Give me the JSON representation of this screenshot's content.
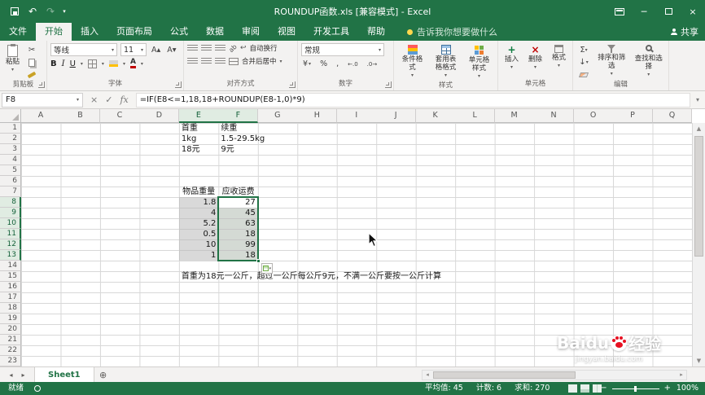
{
  "title_bar": {
    "title": "ROUNDUP函数.xls [兼容模式] - Excel"
  },
  "ribbon": {
    "tabs": [
      {
        "label": "文件",
        "type": "file"
      },
      {
        "label": "开始",
        "active": true
      },
      {
        "label": "插入"
      },
      {
        "label": "页面布局"
      },
      {
        "label": "公式"
      },
      {
        "label": "数据"
      },
      {
        "label": "审阅"
      },
      {
        "label": "视图"
      },
      {
        "label": "开发工具"
      },
      {
        "label": "帮助"
      }
    ],
    "tell_me": "告诉我你想要做什么",
    "share": "共享",
    "clipboard": {
      "paste": "粘贴"
    },
    "font": {
      "name": "等线",
      "size": "11"
    },
    "alignment": {
      "wrap": "自动换行",
      "merge": "合并后居中"
    },
    "number": {
      "format": "常规"
    },
    "styles": {
      "conditional": "条件格式",
      "table": "套用表格格式",
      "cell": "单元格样式"
    },
    "cells": {
      "insert": "插入",
      "delete": "删除",
      "format": "格式"
    },
    "editing": {
      "sort": "排序和筛选",
      "find": "查找和选择"
    },
    "group_labels": [
      "剪贴板",
      "字体",
      "对齐方式",
      "数字",
      "样式",
      "单元格",
      "编辑"
    ]
  },
  "formula_bar": {
    "name_box": "F8",
    "formula": "=IF(E8<=1,18,18+ROUNDUP(E8-1,0)*9)"
  },
  "grid": {
    "columns": [
      "A",
      "B",
      "C",
      "D",
      "E",
      "F",
      "G",
      "H",
      "I",
      "J",
      "K",
      "L",
      "M",
      "N",
      "O",
      "P",
      "Q"
    ],
    "row_count": 23,
    "selected_columns": [
      "E",
      "F"
    ],
    "selected_rows": [
      8,
      9,
      10,
      11,
      12,
      13
    ],
    "cells": [
      {
        "c": "E",
        "r": 1,
        "t": "首重"
      },
      {
        "c": "F",
        "r": 1,
        "t": "续重"
      },
      {
        "c": "E",
        "r": 2,
        "t": "1kg"
      },
      {
        "c": "F",
        "r": 2,
        "t": "1.5-29.5kg",
        "wide": true
      },
      {
        "c": "E",
        "r": 3,
        "t": "18元"
      },
      {
        "c": "F",
        "r": 3,
        "t": "9元"
      },
      {
        "c": "E",
        "r": 7,
        "t": "物品重量",
        "a": "center"
      },
      {
        "c": "F",
        "r": 7,
        "t": "应收运费",
        "a": "center"
      },
      {
        "c": "E",
        "r": 8,
        "t": "1.8",
        "a": "right"
      },
      {
        "c": "E",
        "r": 9,
        "t": "4",
        "a": "right"
      },
      {
        "c": "E",
        "r": 10,
        "t": "5.2",
        "a": "right"
      },
      {
        "c": "E",
        "r": 11,
        "t": "0.5",
        "a": "right"
      },
      {
        "c": "E",
        "r": 12,
        "t": "10",
        "a": "right"
      },
      {
        "c": "E",
        "r": 13,
        "t": "1",
        "a": "right"
      },
      {
        "c": "F",
        "r": 8,
        "t": "27",
        "a": "right"
      },
      {
        "c": "F",
        "r": 9,
        "t": "45",
        "a": "right"
      },
      {
        "c": "F",
        "r": 10,
        "t": "63",
        "a": "right"
      },
      {
        "c": "F",
        "r": 11,
        "t": "18",
        "a": "right"
      },
      {
        "c": "F",
        "r": 12,
        "t": "99",
        "a": "right"
      },
      {
        "c": "F",
        "r": 13,
        "t": "18",
        "a": "right"
      },
      {
        "c": "E",
        "r": 15,
        "t": "首重为18元一公斤，超过一公斤每公斤9元，不满一公斤要按一公斤计算",
        "wide": true
      }
    ],
    "selection": {
      "active_cell": "F8",
      "border_col": "F",
      "border_row_start": 8,
      "border_row_end": 13,
      "fill_col": "E",
      "fill_row_start": 8,
      "fill_row_end": 13
    }
  },
  "sheet_bar": {
    "tabs": [
      {
        "label": "Sheet1",
        "active": true
      }
    ]
  },
  "status_bar": {
    "mode": "就绪",
    "stats": [
      "平均值: 45",
      "计数: 6",
      "求和: 270"
    ],
    "zoom": "100%"
  },
  "watermark": {
    "brand_latin": "Baidu",
    "brand_cn": "经验",
    "domain": "jingyan.baidu.com"
  }
}
